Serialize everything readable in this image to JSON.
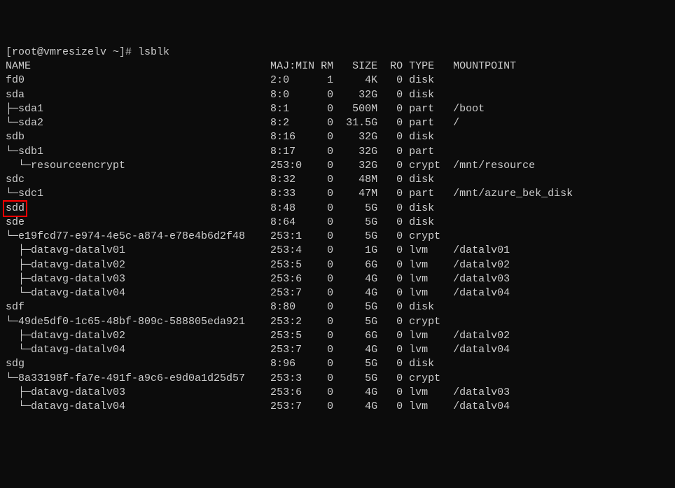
{
  "prompt": "[root@vmresizelv ~]# ",
  "command": "lsblk",
  "header": {
    "name": "NAME",
    "majmin": "MAJ:MIN",
    "rm": "RM",
    "size": "SIZE",
    "ro": "RO",
    "type": "TYPE",
    "mountpoint": "MOUNTPOINT"
  },
  "rows": [
    {
      "name": "fd0",
      "majmin": "2:0",
      "rm": "1",
      "size": "4K",
      "ro": "0",
      "type": "disk",
      "mount": ""
    },
    {
      "name": "sda",
      "majmin": "8:0",
      "rm": "0",
      "size": "32G",
      "ro": "0",
      "type": "disk",
      "mount": ""
    },
    {
      "name": "├─sda1",
      "majmin": "8:1",
      "rm": "0",
      "size": "500M",
      "ro": "0",
      "type": "part",
      "mount": "/boot"
    },
    {
      "name": "└─sda2",
      "majmin": "8:2",
      "rm": "0",
      "size": "31.5G",
      "ro": "0",
      "type": "part",
      "mount": "/"
    },
    {
      "name": "sdb",
      "majmin": "8:16",
      "rm": "0",
      "size": "32G",
      "ro": "0",
      "type": "disk",
      "mount": ""
    },
    {
      "name": "└─sdb1",
      "majmin": "8:17",
      "rm": "0",
      "size": "32G",
      "ro": "0",
      "type": "part",
      "mount": ""
    },
    {
      "name": "  └─resourceencrypt",
      "majmin": "253:0",
      "rm": "0",
      "size": "32G",
      "ro": "0",
      "type": "crypt",
      "mount": "/mnt/resource"
    },
    {
      "name": "sdc",
      "majmin": "8:32",
      "rm": "0",
      "size": "48M",
      "ro": "0",
      "type": "disk",
      "mount": ""
    },
    {
      "name": "└─sdc1",
      "majmin": "8:33",
      "rm": "0",
      "size": "47M",
      "ro": "0",
      "type": "part",
      "mount": "/mnt/azure_bek_disk"
    },
    {
      "name": "sdd",
      "majmin": "8:48",
      "rm": "0",
      "size": "5G",
      "ro": "0",
      "type": "disk",
      "mount": "",
      "highlight": true
    },
    {
      "name": "sde",
      "majmin": "8:64",
      "rm": "0",
      "size": "5G",
      "ro": "0",
      "type": "disk",
      "mount": ""
    },
    {
      "name": "└─e19fcd77-e974-4e5c-a874-e78e4b6d2f48",
      "majmin": "253:1",
      "rm": "0",
      "size": "5G",
      "ro": "0",
      "type": "crypt",
      "mount": ""
    },
    {
      "name": "  ├─datavg-datalv01",
      "majmin": "253:4",
      "rm": "0",
      "size": "1G",
      "ro": "0",
      "type": "lvm",
      "mount": "/datalv01"
    },
    {
      "name": "  ├─datavg-datalv02",
      "majmin": "253:5",
      "rm": "0",
      "size": "6G",
      "ro": "0",
      "type": "lvm",
      "mount": "/datalv02"
    },
    {
      "name": "  ├─datavg-datalv03",
      "majmin": "253:6",
      "rm": "0",
      "size": "4G",
      "ro": "0",
      "type": "lvm",
      "mount": "/datalv03"
    },
    {
      "name": "  └─datavg-datalv04",
      "majmin": "253:7",
      "rm": "0",
      "size": "4G",
      "ro": "0",
      "type": "lvm",
      "mount": "/datalv04"
    },
    {
      "name": "sdf",
      "majmin": "8:80",
      "rm": "0",
      "size": "5G",
      "ro": "0",
      "type": "disk",
      "mount": ""
    },
    {
      "name": "└─49de5df0-1c65-48bf-809c-588805eda921",
      "majmin": "253:2",
      "rm": "0",
      "size": "5G",
      "ro": "0",
      "type": "crypt",
      "mount": ""
    },
    {
      "name": "  ├─datavg-datalv02",
      "majmin": "253:5",
      "rm": "0",
      "size": "6G",
      "ro": "0",
      "type": "lvm",
      "mount": "/datalv02"
    },
    {
      "name": "  └─datavg-datalv04",
      "majmin": "253:7",
      "rm": "0",
      "size": "4G",
      "ro": "0",
      "type": "lvm",
      "mount": "/datalv04"
    },
    {
      "name": "sdg",
      "majmin": "8:96",
      "rm": "0",
      "size": "5G",
      "ro": "0",
      "type": "disk",
      "mount": ""
    },
    {
      "name": "└─8a33198f-fa7e-491f-a9c6-e9d0a1d25d57",
      "majmin": "253:3",
      "rm": "0",
      "size": "5G",
      "ro": "0",
      "type": "crypt",
      "mount": ""
    },
    {
      "name": "  ├─datavg-datalv03",
      "majmin": "253:6",
      "rm": "0",
      "size": "4G",
      "ro": "0",
      "type": "lvm",
      "mount": "/datalv03"
    },
    {
      "name": "  └─datavg-datalv04",
      "majmin": "253:7",
      "rm": "0",
      "size": "4G",
      "ro": "0",
      "type": "lvm",
      "mount": "/datalv04"
    }
  ]
}
